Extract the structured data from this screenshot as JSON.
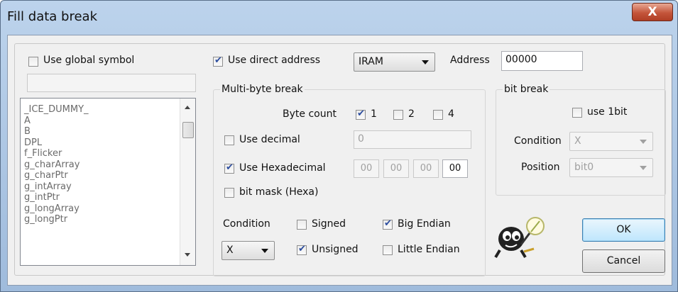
{
  "window": {
    "title": "Fill data break",
    "close_glyph": "X"
  },
  "symbols": {
    "use_global_symbol_label": "Use global symbol",
    "use_global_symbol_checked": false,
    "filter_value": "",
    "items": [
      "_ICE_DUMMY_",
      "A",
      "B",
      "DPL",
      "f_Flicker",
      "g_charArray",
      "g_charPtr",
      "g_intArray",
      "g_intPtr",
      "g_longArray",
      "g_longPtr"
    ]
  },
  "address": {
    "use_direct_address_label": "Use direct address",
    "use_direct_address_checked": true,
    "memory_type": "IRAM",
    "address_label": "Address",
    "address_value": "00000"
  },
  "multi_byte": {
    "group_label": "Multi-byte break",
    "byte_count_label": "Byte count",
    "byte_counts": [
      {
        "label": "1",
        "checked": true
      },
      {
        "label": "2",
        "checked": false
      },
      {
        "label": "4",
        "checked": false
      }
    ],
    "use_decimal_label": "Use decimal",
    "use_decimal_checked": false,
    "decimal_value": "0",
    "use_hex_label": "Use Hexadecimal",
    "use_hex_checked": true,
    "hex_values": [
      "00",
      "00",
      "00",
      "00"
    ],
    "bit_mask_label": "bit mask (Hexa)",
    "bit_mask_checked": false,
    "condition_label": "Condition",
    "condition_value": "X",
    "signed_label": "Signed",
    "signed_checked": false,
    "unsigned_label": "Unsigned",
    "unsigned_checked": true,
    "big_endian_label": "Big Endian",
    "big_endian_checked": true,
    "little_endian_label": "Little Endian",
    "little_endian_checked": false
  },
  "bit_break": {
    "group_label": "bit break",
    "use_1bit_label": "use 1bit",
    "use_1bit_checked": false,
    "condition_label": "Condition",
    "condition_value": "X",
    "position_label": "Position",
    "position_value": "bit0"
  },
  "buttons": {
    "ok": "OK",
    "cancel": "Cancel"
  },
  "icons": {
    "mascot": "mascot-icon",
    "close": "close-icon",
    "chevron": "chevron-down-icon"
  },
  "colors": {
    "title_bg": "#bcd3ec",
    "close_bg": "#c4553b",
    "dialog_bg": "#f0f0f0",
    "check": "#2b4c9e"
  }
}
